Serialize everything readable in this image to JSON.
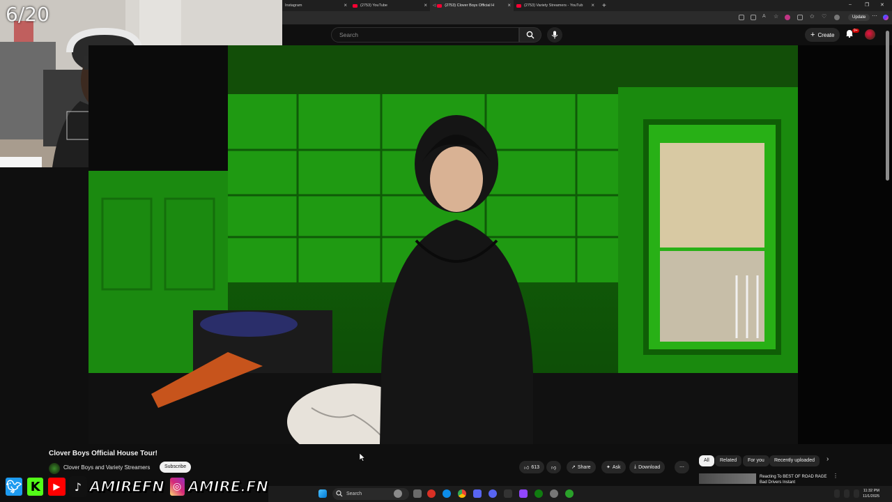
{
  "overlay": {
    "counter": "6/20"
  },
  "browser": {
    "tabs": [
      {
        "label": "Instagram",
        "active": false
      },
      {
        "label": "(2753) YouTube",
        "active": false
      },
      {
        "label": "(2753) Clover Boys Official H",
        "active": true
      },
      {
        "label": "(2753) Variety Streamers - YouTub",
        "active": false
      }
    ],
    "update_label": "Update"
  },
  "youtube": {
    "search_placeholder": "Search",
    "create_label": "Create",
    "notif_count": "9+"
  },
  "video": {
    "title": "Clover Boys Official House Tour!",
    "channel": "Clover Boys and Variety Streamers",
    "subscribe_label": "Subscribe",
    "like_count": "613",
    "share_label": "Share",
    "ask_label": "Ask",
    "download_label": "Download"
  },
  "chips": [
    "All",
    "Related",
    "For you",
    "Recently uploaded"
  ],
  "recommendation": {
    "title": "Reacting To BEST OF ROAD RAGE Bad Drivers Instant"
  },
  "social": {
    "handle1": "AMIREFN",
    "handle2": "AMIRE.FN",
    "kick_letter": "K"
  },
  "taskbar": {
    "search_label": "Search",
    "time": "11:32 PM",
    "date": "11/1/2025"
  },
  "colors": {
    "youtube_red": "#ff0033",
    "wall_green": "#1f9e10",
    "twitter_blue": "#1d9bf0",
    "kick_green": "#53fc18"
  }
}
